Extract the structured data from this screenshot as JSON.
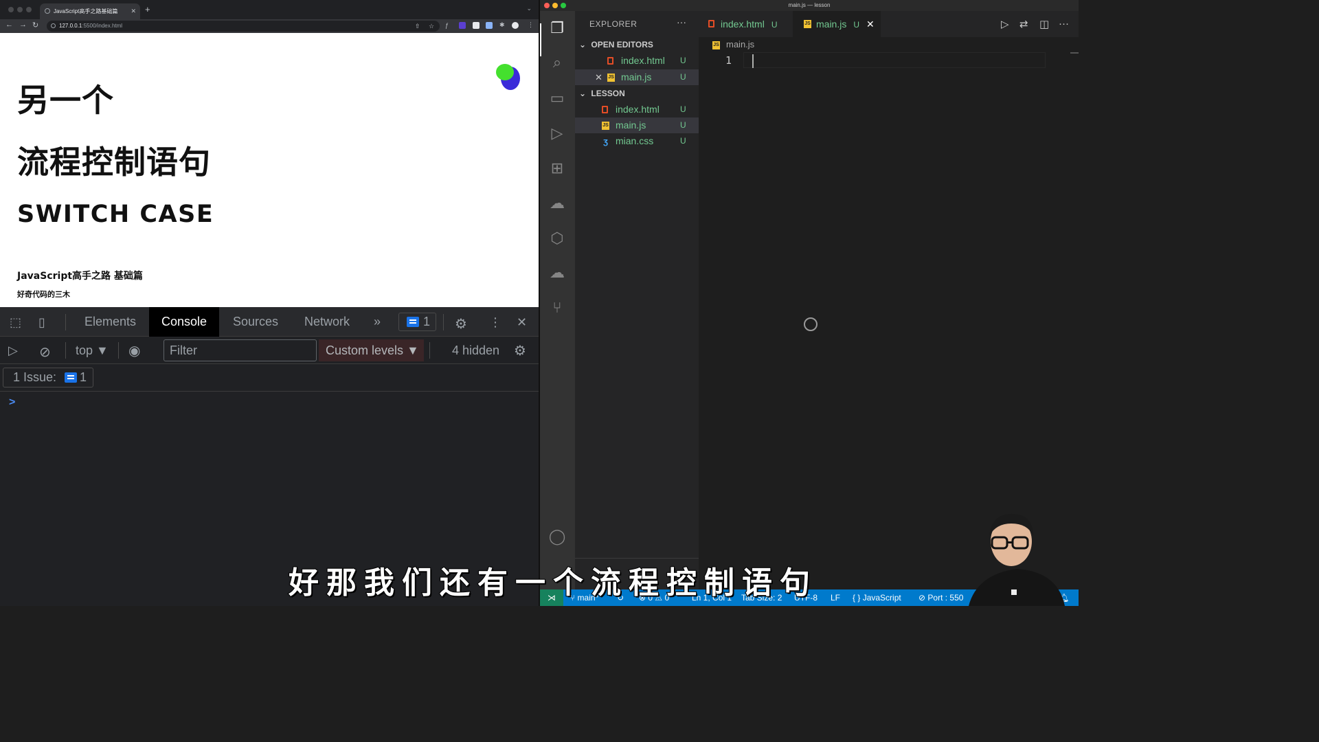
{
  "browser": {
    "tab_title": "JavaScript高手之路基础篇",
    "url_host": "127.0.0.1",
    "url_path": ":5500/index.html"
  },
  "page": {
    "line1": "另一个",
    "line2": "流程控制语句",
    "line3": "SWITCH CASE",
    "course": "JavaScript高手之路 基础篇",
    "author": "好奇代码的三木"
  },
  "devtools": {
    "tabs": [
      "Elements",
      "Console",
      "Sources",
      "Network"
    ],
    "more_tabs": "»",
    "issues_count": "1",
    "context": "top ▼",
    "filter_placeholder": "Filter",
    "levels": "Custom levels ▼",
    "hidden": "4 hidden",
    "issue_label": "1 Issue:",
    "issue_count": "1",
    "prompt": ">"
  },
  "vscode": {
    "window_title": "main.js — lesson",
    "explorer_title": "EXPLORER",
    "more": "···",
    "open_editors_label": "OPEN EDITORS",
    "open_editors": [
      {
        "name": "index.html",
        "status": "U"
      },
      {
        "name": "main.js",
        "status": "U"
      }
    ],
    "folder_label": "LESSON",
    "files": [
      {
        "name": "index.html",
        "status": "U"
      },
      {
        "name": "main.js",
        "status": "U"
      },
      {
        "name": "mian.css",
        "status": "U"
      }
    ],
    "tabs": [
      {
        "name": "index.html",
        "status": "U"
      },
      {
        "name": "main.js",
        "status": "U"
      }
    ],
    "breadcrumb": "main.js",
    "line_number": "1",
    "status": {
      "branch": "main*",
      "errors": "0",
      "warnings": "0",
      "position": "Ln 1, Col 1",
      "tab_size": "Tab Size: 2",
      "encoding": "UTF-8",
      "eol": "LF",
      "language": "JavaScript",
      "port": "Port : 550"
    }
  },
  "subtitle": "好那我们还有一个流程控制语句",
  "colors": {
    "vscode_status": "#007acc",
    "git_untracked": "#73c991",
    "devtools_bg": "#202124"
  }
}
